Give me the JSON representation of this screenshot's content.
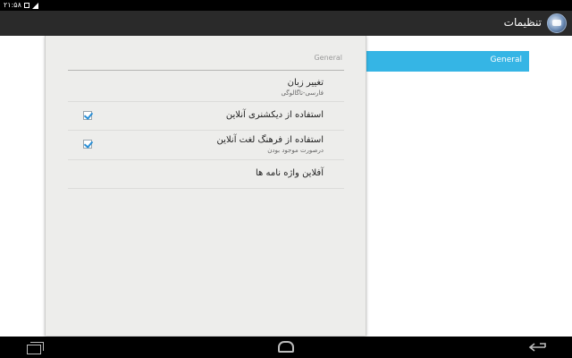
{
  "status_bar": {
    "time": "۲۱:۵۸"
  },
  "action_bar": {
    "title": "تنظیمات",
    "logo_icon": "app-logo-globe-icon"
  },
  "header_panel": {
    "label": "General"
  },
  "settings": {
    "category": "General",
    "items": [
      {
        "title": "تغییر زبان",
        "summary": "فارسی-تاگالوگی",
        "has_checkbox": false
      },
      {
        "title": "استفاده از دیکشنری آنلاین",
        "summary": "",
        "checked": true
      },
      {
        "title": "استفاده از فرهنگ لغت آنلاین",
        "summary": "درصورت موجود بودن",
        "checked": true
      },
      {
        "title": "آفلاین واژه نامه ها",
        "summary": "",
        "has_checkbox": false
      }
    ]
  },
  "colors": {
    "accent": "#35b5e5",
    "checkmark": "#2a8fd6",
    "action_bar": "#2a2a2a"
  }
}
